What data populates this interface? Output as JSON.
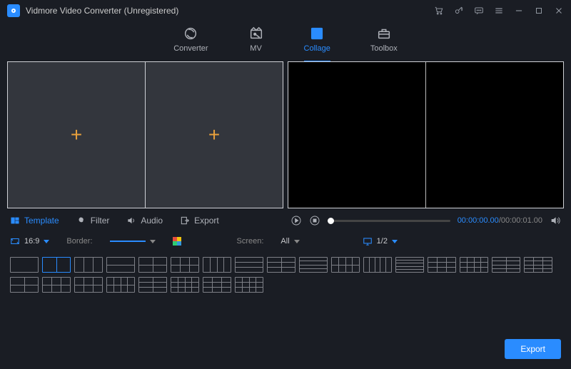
{
  "app": {
    "title": "Vidmore Video Converter (Unregistered)"
  },
  "titlebar_icons": [
    "cart",
    "key",
    "feedback",
    "menu",
    "minimize",
    "maximize",
    "close"
  ],
  "nav": {
    "tabs": [
      {
        "id": "converter",
        "label": "Converter"
      },
      {
        "id": "mv",
        "label": "MV"
      },
      {
        "id": "collage",
        "label": "Collage"
      },
      {
        "id": "toolbox",
        "label": "Toolbox"
      }
    ],
    "active": "collage"
  },
  "subtabs": {
    "items": [
      {
        "id": "template",
        "label": "Template"
      },
      {
        "id": "filter",
        "label": "Filter"
      },
      {
        "id": "audio",
        "label": "Audio"
      },
      {
        "id": "export",
        "label": "Export"
      }
    ],
    "active": "template"
  },
  "playback": {
    "current": "00:00:00.00",
    "total": "00:00:01.00",
    "position": 0
  },
  "options": {
    "aspect_ratio": "16:9",
    "border_label": "Border:",
    "screen_label": "Screen:",
    "screen_value": "All",
    "display": "1/2"
  },
  "templates": {
    "row1_count": 17,
    "row2_count": 8,
    "selected_index": 1
  },
  "footer": {
    "export_label": "Export"
  }
}
